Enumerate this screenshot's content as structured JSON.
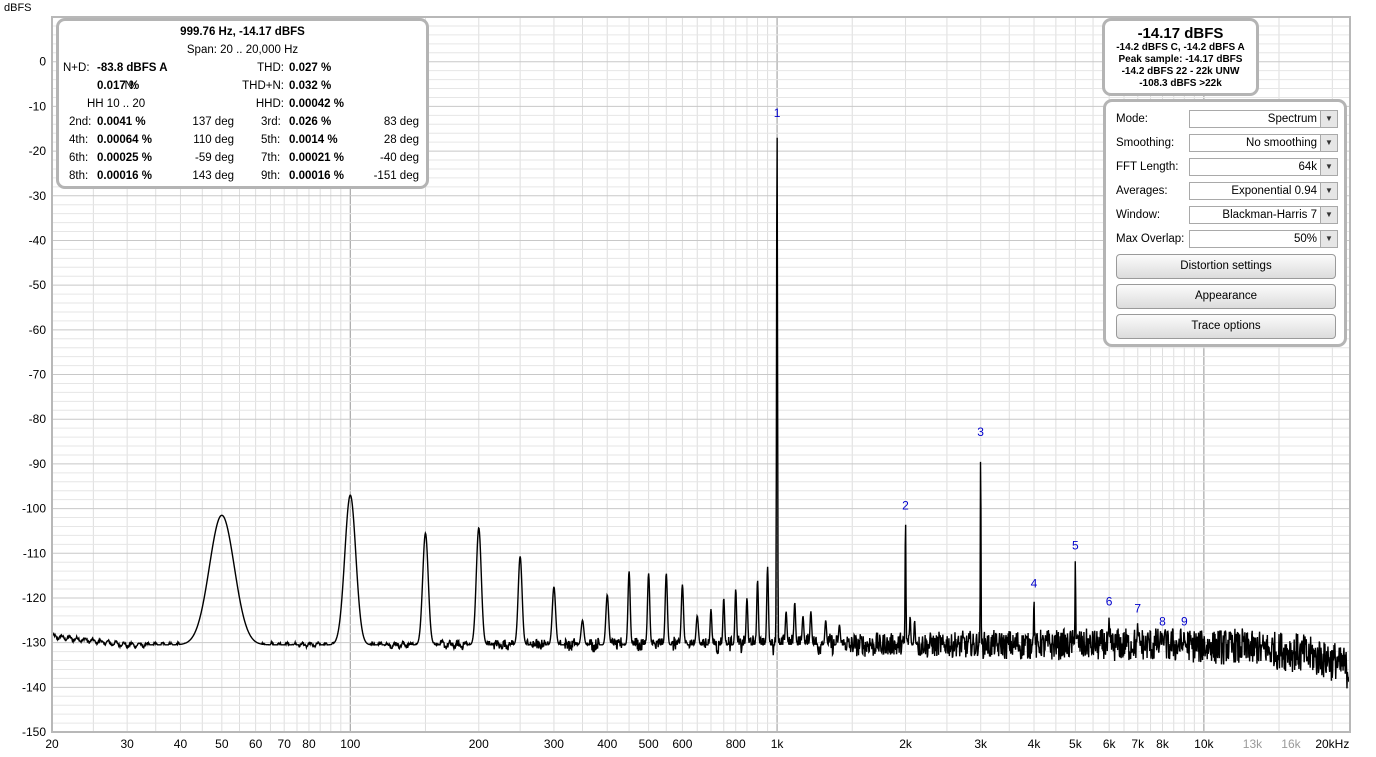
{
  "chart_data": {
    "type": "line",
    "ylabel": "dBFS",
    "xscale": "log",
    "xlim": [
      20,
      22000
    ],
    "ylim": [
      -150,
      10
    ],
    "y_ticks": [
      "0",
      "-10",
      "-20",
      "-30",
      "-40",
      "-50",
      "-60",
      "-70",
      "-80",
      "-90",
      "-100",
      "-110",
      "-120",
      "-130",
      "-140",
      "-150"
    ],
    "x_ticks": [
      {
        "v": 20,
        "l": "20"
      },
      {
        "v": 30,
        "l": "30"
      },
      {
        "v": 40,
        "l": "40"
      },
      {
        "v": 50,
        "l": "50"
      },
      {
        "v": 60,
        "l": "60"
      },
      {
        "v": 70,
        "l": "70"
      },
      {
        "v": 80,
        "l": "80"
      },
      {
        "v": 100,
        "l": "100"
      },
      {
        "v": 200,
        "l": "200"
      },
      {
        "v": 300,
        "l": "300"
      },
      {
        "v": 400,
        "l": "400"
      },
      {
        "v": 500,
        "l": "500"
      },
      {
        "v": 600,
        "l": "600"
      },
      {
        "v": 800,
        "l": "800"
      },
      {
        "v": 1000,
        "l": "1k"
      },
      {
        "v": 2000,
        "l": "2k"
      },
      {
        "v": 3000,
        "l": "3k"
      },
      {
        "v": 4000,
        "l": "4k"
      },
      {
        "v": 5000,
        "l": "5k"
      },
      {
        "v": 6000,
        "l": "6k"
      },
      {
        "v": 7000,
        "l": "7k"
      },
      {
        "v": 8000,
        "l": "8k"
      },
      {
        "v": 10000,
        "l": "10k"
      },
      {
        "v": 13000,
        "l": "13k",
        "muted": true
      },
      {
        "v": 16000,
        "l": "16k",
        "muted": true
      },
      {
        "v": 20000,
        "l": "20kHz"
      }
    ],
    "noise_floor": [
      {
        "x": 20,
        "y": -128.6
      },
      {
        "x": 30,
        "y": -130.5
      },
      {
        "x": 50,
        "y": -130.5
      },
      {
        "x": 100,
        "y": -130.5
      },
      {
        "x": 300,
        "y": -130.5
      },
      {
        "x": 1000,
        "y": -130.5
      },
      {
        "x": 3000,
        "y": -130.5
      },
      {
        "x": 8000,
        "y": -130.5
      },
      {
        "x": 12000,
        "y": -131
      },
      {
        "x": 16000,
        "y": -132
      },
      {
        "x": 20000,
        "y": -134
      },
      {
        "x": 22000,
        "y": -136
      }
    ],
    "peaks": [
      {
        "x": 50,
        "y": -101.5,
        "w": 0.045
      },
      {
        "x": 100,
        "y": -97,
        "w": 0.02
      },
      {
        "x": 150,
        "y": -105.5,
        "w": 0.01
      },
      {
        "x": 200,
        "y": -104.3,
        "w": 0.009
      },
      {
        "x": 250,
        "y": -110.7,
        "w": 0.007
      },
      {
        "x": 300,
        "y": -117.5,
        "w": 0.006
      },
      {
        "x": 350,
        "y": -125,
        "w": 0.005
      },
      {
        "x": 400,
        "y": -119.3,
        "w": 0.005
      },
      {
        "x": 450,
        "y": -114,
        "w": 0.004
      },
      {
        "x": 500,
        "y": -114.5,
        "w": 0.004
      },
      {
        "x": 550,
        "y": -114.5,
        "w": 0.004
      },
      {
        "x": 600,
        "y": -117,
        "w": 0.004
      },
      {
        "x": 650,
        "y": -124,
        "w": 0.004
      },
      {
        "x": 700,
        "y": -122.5,
        "w": 0.003
      },
      {
        "x": 750,
        "y": -120,
        "w": 0.003
      },
      {
        "x": 800,
        "y": -118,
        "w": 0.003
      },
      {
        "x": 850,
        "y": -120,
        "w": 0.003
      },
      {
        "x": 900,
        "y": -116,
        "w": 0.003
      },
      {
        "x": 950,
        "y": -113,
        "w": 0.003
      },
      {
        "x": 999.76,
        "y": -14.17,
        "w": 0.0018
      },
      {
        "x": 1050,
        "y": -123,
        "w": 0.003
      },
      {
        "x": 1100,
        "y": -121,
        "w": 0.003
      },
      {
        "x": 1150,
        "y": -124,
        "w": 0.003
      },
      {
        "x": 1200,
        "y": -123,
        "w": 0.003
      },
      {
        "x": 1300,
        "y": -125,
        "w": 0.003
      },
      {
        "x": 1400,
        "y": -126,
        "w": 0.003
      },
      {
        "x": 1999.5,
        "y": -102,
        "w": 0.0015
      },
      {
        "x": 2050,
        "y": -124,
        "w": 0.002
      },
      {
        "x": 2100,
        "y": -125,
        "w": 0.002
      },
      {
        "x": 2999,
        "y": -85.5,
        "w": 0.0012
      },
      {
        "x": 3999,
        "y": -119.5,
        "w": 0.0012
      },
      {
        "x": 4999,
        "y": -111,
        "w": 0.0012
      },
      {
        "x": 5999,
        "y": -123.5,
        "w": 0.001
      },
      {
        "x": 6998,
        "y": -125,
        "w": 0.001
      },
      {
        "x": 7998,
        "y": -128,
        "w": 0.001
      },
      {
        "x": 8998,
        "y": -128,
        "w": 0.001
      }
    ],
    "harmonic_labels": [
      {
        "x": 999.76,
        "y": -14.17,
        "label": "1"
      },
      {
        "x": 1999.5,
        "y": -102,
        "label": "2"
      },
      {
        "x": 2999,
        "y": -85.5,
        "label": "3"
      },
      {
        "x": 3999,
        "y": -119.5,
        "label": "4"
      },
      {
        "x": 4999,
        "y": -111,
        "label": "5"
      },
      {
        "x": 5999,
        "y": -123.5,
        "label": "6"
      },
      {
        "x": 6998,
        "y": -125,
        "label": "7"
      },
      {
        "x": 7998,
        "y": -128,
        "label": "8"
      },
      {
        "x": 8998,
        "y": -128,
        "label": "9"
      }
    ],
    "trace_color": "#000000",
    "label_color": "#0000cc",
    "grid": true
  },
  "stats": {
    "peak": "999.76 Hz, -14.17 dBFS",
    "span": "Span: 20 .. 20,000 Hz",
    "nd_label": "N+D:",
    "nd_value": "-83.8 dBFS A",
    "thd_label": "THD:",
    "thd_value": "0.027 %",
    "n_label": "N:",
    "n_value": "0.017 %",
    "thdn_label": "THD+N:",
    "thdn_value": "0.032 %",
    "hh_label": "HH 10 .. 20",
    "hhd_label": "HHD:",
    "hhd_value": "0.00042 %",
    "harmonics": [
      {
        "label": "2nd:",
        "value": "0.0041 %",
        "phase": "137 deg"
      },
      {
        "label": "3rd:",
        "value": "0.026 %",
        "phase": "83 deg"
      },
      {
        "label": "4th:",
        "value": "0.00064 %",
        "phase": "110 deg"
      },
      {
        "label": "5th:",
        "value": "0.0014 %",
        "phase": "28 deg"
      },
      {
        "label": "6th:",
        "value": "0.00025 %",
        "phase": "-59 deg"
      },
      {
        "label": "7th:",
        "value": "0.00021 %",
        "phase": "-40 deg"
      },
      {
        "label": "8th:",
        "value": "0.00016 %",
        "phase": "143 deg"
      },
      {
        "label": "9th:",
        "value": "0.00016 %",
        "phase": "-151 deg"
      }
    ]
  },
  "level": {
    "main": "-14.17 dBFS",
    "lines": [
      "-14.2 dBFS C, -14.2 dBFS A",
      "Peak sample: -14.17 dBFS",
      "-14.2 dBFS 22 - 22k UNW",
      "-108.3 dBFS >22k"
    ]
  },
  "controls": {
    "rows": [
      {
        "label": "Mode:",
        "value": "Spectrum"
      },
      {
        "label": "Smoothing:",
        "value": "No  smoothing"
      },
      {
        "label": "FFT Length:",
        "value": "64k"
      },
      {
        "label": "Averages:",
        "value": "Exponential 0.94"
      },
      {
        "label": "Window:",
        "value": "Blackman-Harris 7"
      },
      {
        "label": "Max Overlap:",
        "value": "50%"
      }
    ],
    "buttons": [
      "Distortion settings",
      "Appearance",
      "Trace options"
    ]
  }
}
